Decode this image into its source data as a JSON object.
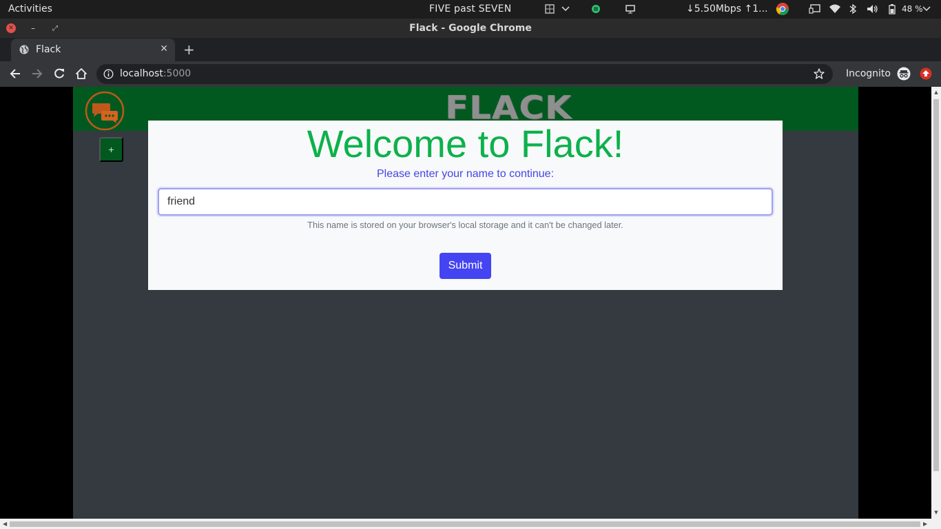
{
  "system_bar": {
    "activities": "Activities",
    "clock": "FIVE past SEVEN",
    "network_speed": "↓5.50Mbps ↑1...",
    "battery": "48 %"
  },
  "window": {
    "title": "Flack - Google Chrome"
  },
  "browser": {
    "tab": {
      "title": "Flack"
    },
    "address": {
      "host": "localhost",
      "port": ":5000"
    },
    "profile_label": "Incognito"
  },
  "app": {
    "brand": "FLACK",
    "add_channel_label": "+",
    "modal": {
      "heading": "Welcome to Flack!",
      "prompt": "Please enter your name to continue:",
      "name_value": "friend",
      "hint": "This name is stored on your browser's local storage and it can't be changed later.",
      "submit_label": "Submit"
    }
  },
  "colors": {
    "header_green": "#02591f",
    "heading_green": "#0cb14b",
    "prompt_blue": "#4444e6",
    "button_blue": "#4444f2",
    "app_background": "#343a40",
    "logo_orange": "#c0581c"
  },
  "icons": [
    "globe-icon",
    "back-arrow-icon",
    "forward-arrow-icon",
    "reload-icon",
    "home-icon",
    "info-icon",
    "star-icon",
    "incognito-icon",
    "update-icon",
    "chat-bubbles-icon"
  ]
}
